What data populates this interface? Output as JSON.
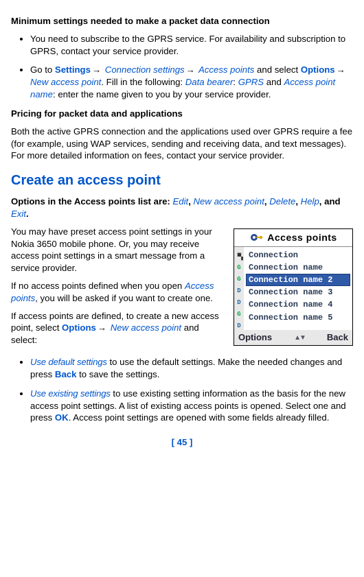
{
  "heading1": "Minimum settings needed to make a packet data connection",
  "bullets1": [
    {
      "pre": "You need to subscribe to the GPRS service. For availability and subscription to GPRS, contact your service provider."
    }
  ],
  "bullet2": {
    "t1": "Go to ",
    "settings": "Settings",
    "arr": "→",
    "conn": " Connection settings",
    "ap": " Access points",
    "t2": " and select ",
    "options": "Options",
    "nap": " New access point",
    "t3": ". Fill in the following: ",
    "db": "Data bearer",
    "t4": ": ",
    "gprs": "GPRS",
    "t5": " and ",
    "apn": "Access point name",
    "t6": ": enter the name given to you by your service provider."
  },
  "heading2": "Pricing for packet data and applications",
  "para2": "Both the active GPRS connection and the applications used over GPRS require a fee (for example, using WAP services, sending and receiving data, and text messages). For more detailed information on fees, contact your service provider.",
  "section": "Create an access point",
  "opts_line": {
    "lead": "Options in the Access points list are: ",
    "edit": "Edit",
    "c": ", ",
    "nap": "New access point",
    "del": "Delete",
    "help": "Help",
    "and": ", and ",
    "exit": "Exit",
    "dot": "."
  },
  "para3": "You may have preset access point settings in your Nokia 3650 mobile phone. Or, you may receive access point settings in a smart message from a service provider.",
  "para4": {
    "t1": "If no access points defined when you open ",
    "ap": "Access points",
    "t2": ", you will be asked if you want to create one."
  },
  "para5": {
    "t1": "If access points are defined, to create a new access point, select ",
    "options": "Options",
    "arr": "→",
    "nap": " New access point",
    "t2": " and select:"
  },
  "bullets2": [
    {
      "lead": "Use default settings",
      "t1": " to use the default settings. Make the needed changes and press ",
      "back": "Back",
      "t2": " to save the settings."
    },
    {
      "lead": "Use existing settings",
      "t1": " to use existing setting information as the basis for the new access point settings. A list of existing access points is opened. Select one and press ",
      "ok": "OK",
      "t2": ". Access point settings are opened with some fields already filled."
    }
  ],
  "phone": {
    "title": "Access points",
    "rows": [
      "Connection",
      "Connection name",
      "Connection name 2",
      "Connection name 3",
      "Connection name 4",
      "Connection name 5"
    ],
    "selected_index": 2,
    "soft_left": "Options",
    "soft_right": "Back"
  },
  "page": "[ 45 ]"
}
